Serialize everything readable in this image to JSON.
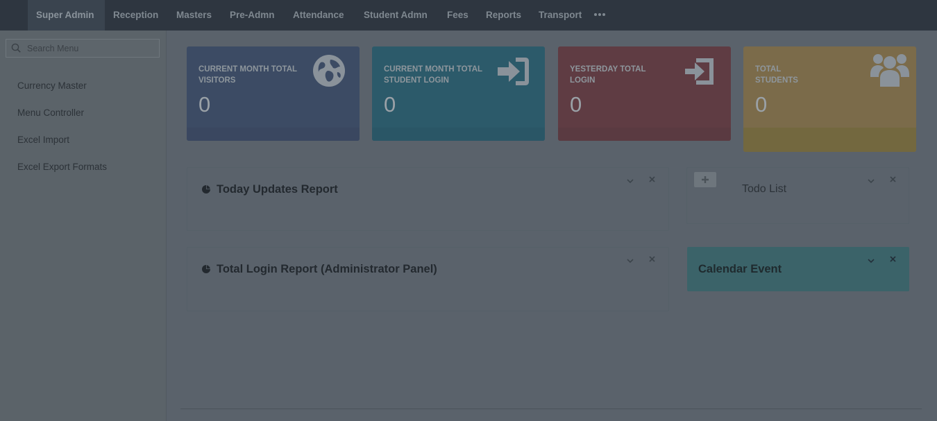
{
  "topnav": {
    "items": [
      {
        "label": "Super Admin"
      },
      {
        "label": "Reception"
      },
      {
        "label": "Masters"
      },
      {
        "label": "Pre-Admn"
      },
      {
        "label": "Attendance"
      },
      {
        "label": "Student Admn"
      },
      {
        "label": "Fees"
      },
      {
        "label": "Reports"
      },
      {
        "label": "Transport"
      }
    ],
    "active_index": 0,
    "more_icon": "ellipsis-icon"
  },
  "sidebar": {
    "search_placeholder": "Search Menu",
    "items": [
      {
        "label": "Currency Master"
      },
      {
        "label": "Menu Controller"
      },
      {
        "label": "Excel Import"
      },
      {
        "label": "Excel Export Formats"
      }
    ]
  },
  "stats": [
    {
      "line1": "CURRENT MONTH TOTAL",
      "line2": "VISITORS",
      "value": "0",
      "icon": "globe-icon",
      "color": "#3c4b64"
    },
    {
      "line1": "CURRENT MONTH TOTAL",
      "line2": "STUDENT LOGIN",
      "value": "0",
      "icon": "sign-in-icon",
      "color": "#2c5a6a"
    },
    {
      "line1": "YESTERDAY TOTAL",
      "line2": "LOGIN",
      "value": "0",
      "icon": "login-icon",
      "color": "#5f3c43"
    },
    {
      "line1": "TOTAL",
      "line2": "STUDENTS",
      "value": "0",
      "icon": "users-icon",
      "color": "#7b6b4a"
    }
  ],
  "panels": {
    "today_updates": {
      "title": "Today Updates Report"
    },
    "total_login": {
      "title": "Total Login Report (Administrator Panel)"
    },
    "todo": {
      "title": "Todo List"
    },
    "calendar": {
      "title": "Calendar Event",
      "color": "#3b6369"
    }
  }
}
